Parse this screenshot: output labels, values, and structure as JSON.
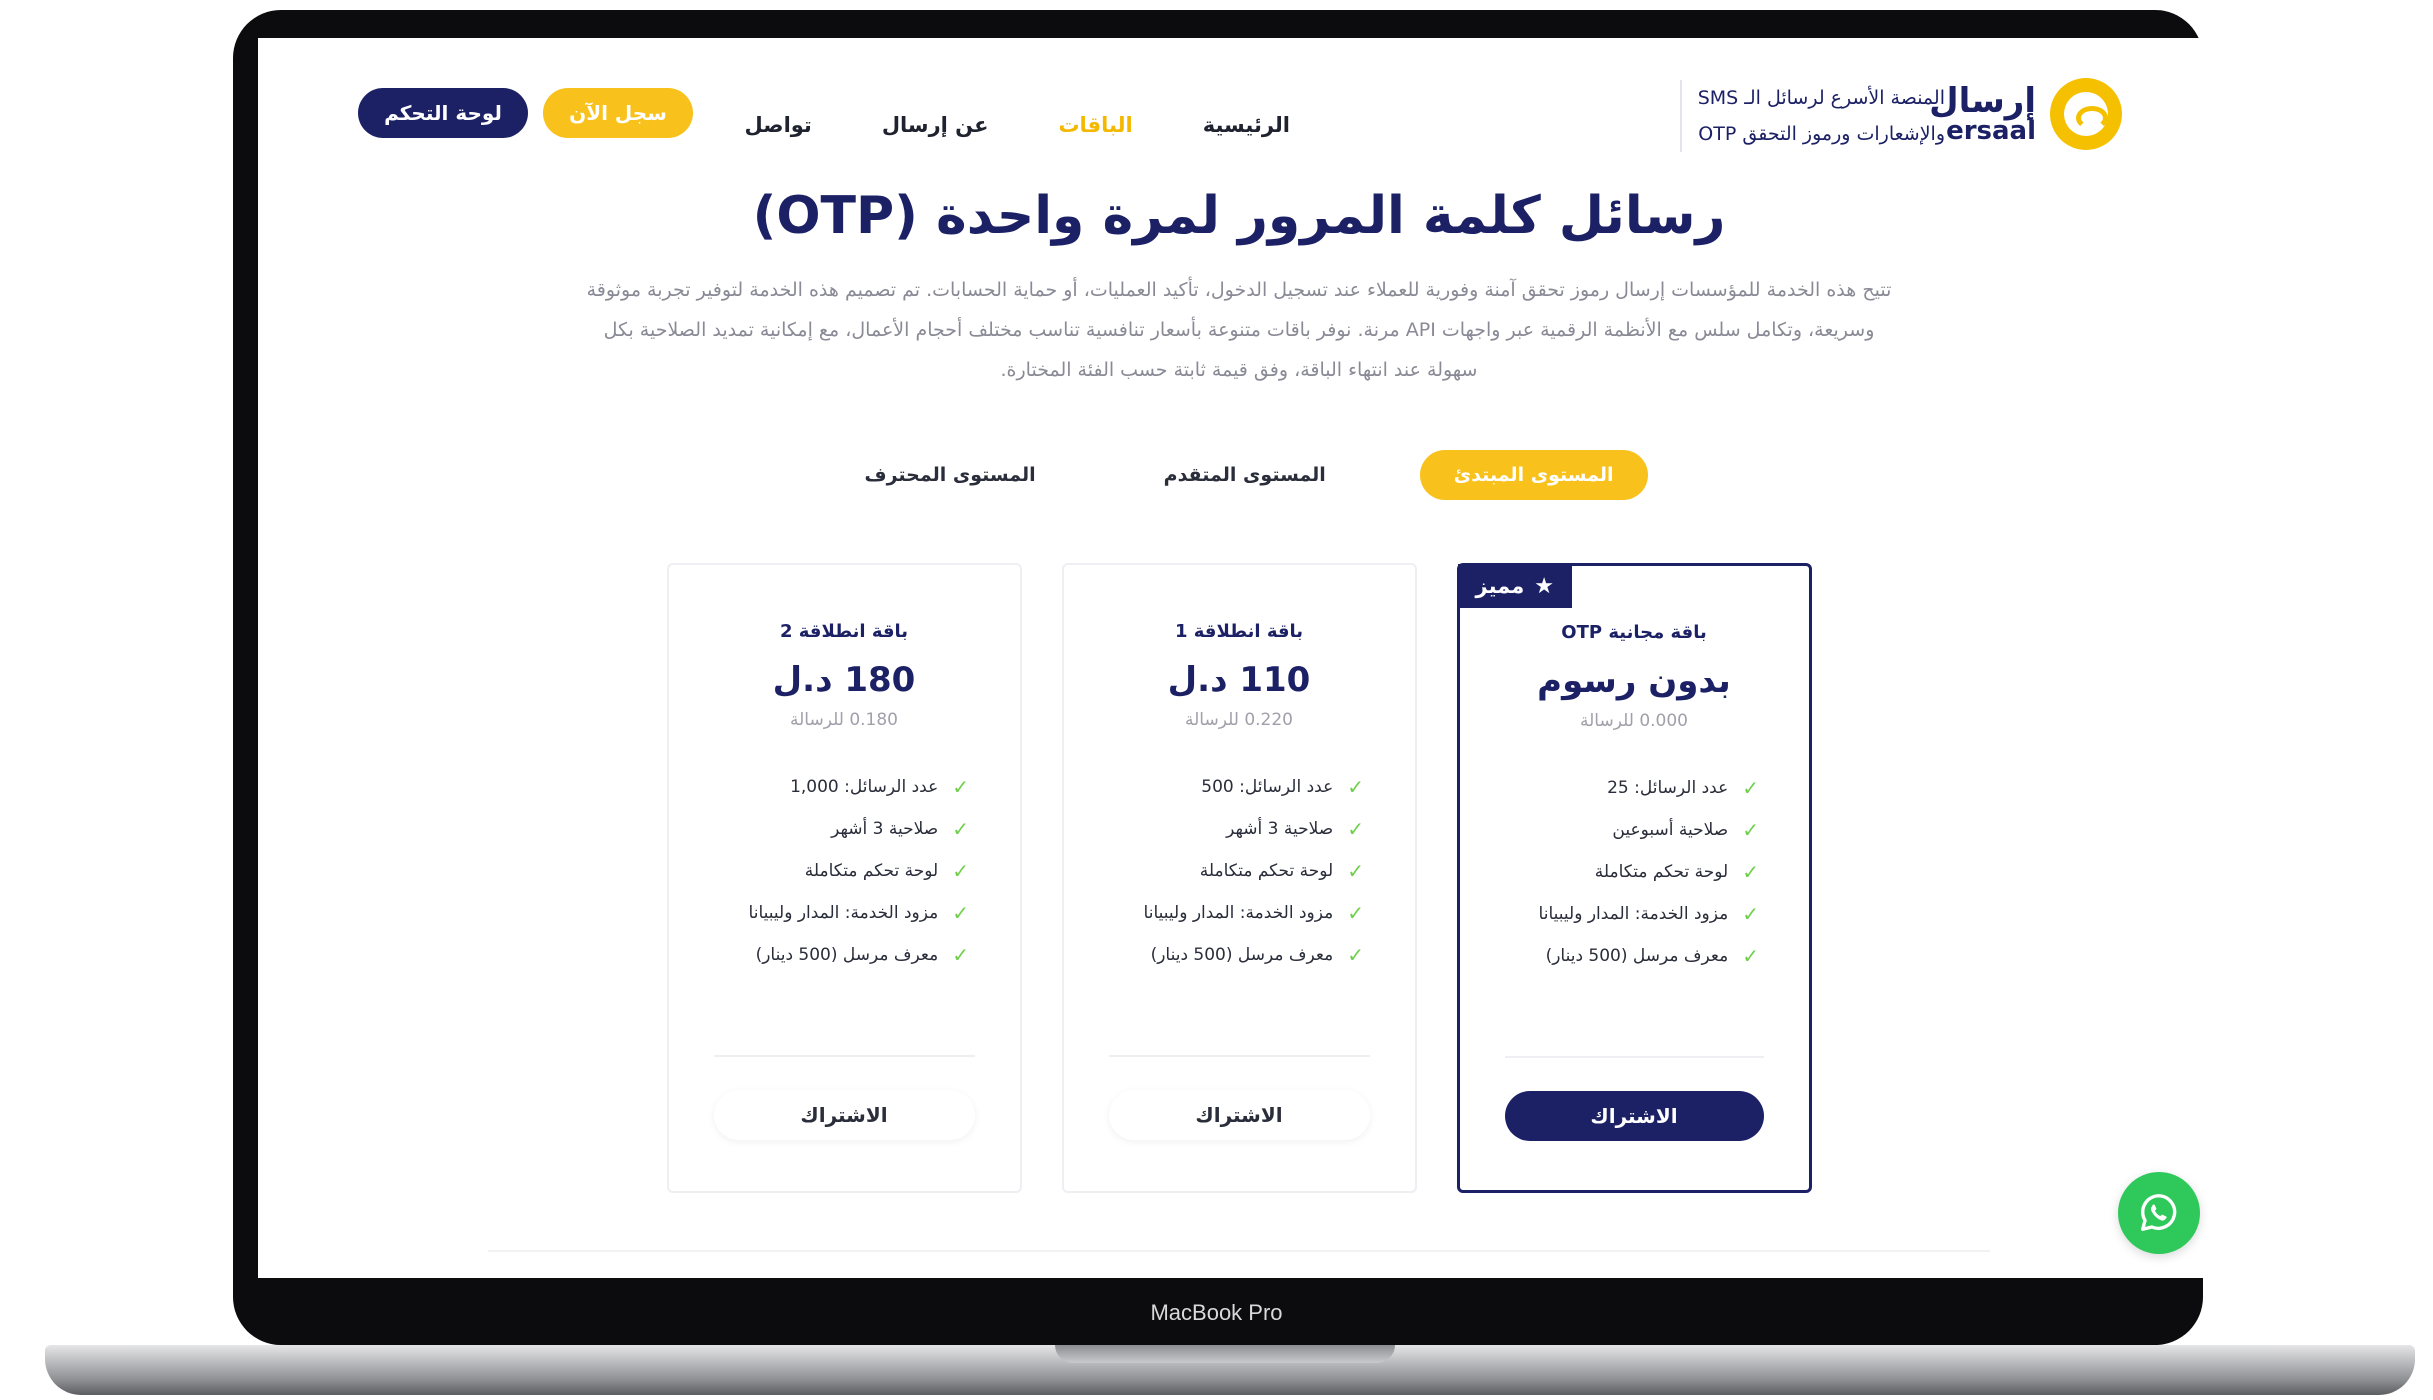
{
  "device_label": "MacBook Pro",
  "brand": {
    "name_ar": "إرسال",
    "name_en": "ersaal"
  },
  "tagline": {
    "line1": "المنصة الأسرع لرسائل الـ SMS",
    "line2": "والإشعارات ورموز التحقق OTP"
  },
  "nav": {
    "home": "الرئيسية",
    "packages": "الباقات",
    "about": "عن إرسال",
    "contact": "تواصل"
  },
  "buttons": {
    "register": "سجل الآن",
    "dashboard": "لوحة التحكم"
  },
  "page": {
    "title": "رسائل كلمة المرور لمرة واحدة (OTP)",
    "description": "تتيح هذه الخدمة للمؤسسات إرسال رموز تحقق آمنة وفورية للعملاء عند تسجيل الدخول، تأكيد العمليات، أو حماية الحسابات. تم تصميم هذه الخدمة لتوفير تجربة موثوقة وسريعة، وتكامل سلس مع الأنظمة الرقمية عبر واجهات API مرنة. نوفر باقات متنوعة بأسعار تنافسية تناسب مختلف أحجام الأعمال، مع إمكانية تمديد الصلاحية بكل سهولة عند انتهاء الباقة، وفق قيمة ثابتة حسب الفئة المختارة."
  },
  "tabs": [
    {
      "label": "المستوى المبتدئ",
      "active": true
    },
    {
      "label": "المستوى المتقدم",
      "active": false
    },
    {
      "label": "المستوى المحترف",
      "active": false
    }
  ],
  "cards": [
    {
      "featured": true,
      "badge": "مميز",
      "name": "باقة مجانية OTP",
      "price": "بدون رسوم",
      "unit": "0.000 للرسالة",
      "features": [
        "عدد الرسائل: 25",
        "صلاحية أسبوعين",
        "لوحة تحكم متكاملة",
        "مزود الخدمة: المدار وليبيانا",
        "معرف مرسل (500 دينار)"
      ],
      "cta": "الاشتراك"
    },
    {
      "featured": false,
      "name": "باقة انطلاقة 1",
      "price": "110 د.ل",
      "unit": "0.220 للرسالة",
      "features": [
        "عدد الرسائل: 500",
        "صلاحية 3 أشهر",
        "لوحة تحكم متكاملة",
        "مزود الخدمة: المدار وليبيانا",
        "معرف مرسل (500 دينار)"
      ],
      "cta": "الاشتراك"
    },
    {
      "featured": false,
      "name": "باقة انطلاقة 2",
      "price": "180 د.ل",
      "unit": "0.180 للرسالة",
      "features": [
        "عدد الرسائل: 1,000",
        "صلاحية 3 أشهر",
        "لوحة تحكم متكاملة",
        "مزود الخدمة: المدار وليبيانا",
        "معرف مرسل (500 دينار)"
      ],
      "cta": "الاشتراك"
    }
  ],
  "colors": {
    "navy": "#1c2166",
    "yellow": "#f8c11b",
    "green": "#2ec95a"
  }
}
